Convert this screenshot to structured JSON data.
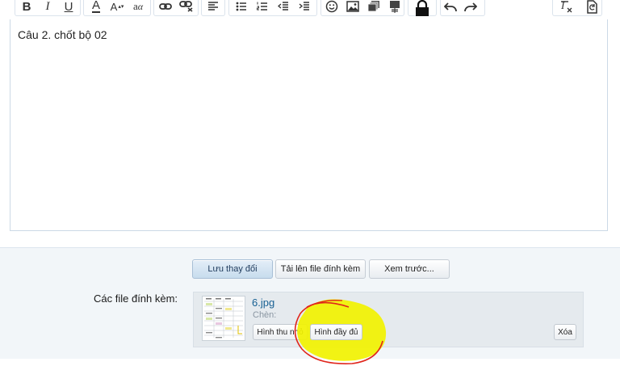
{
  "toolbar": {
    "icons": [
      "bold-icon",
      "italic-icon",
      "underline-icon",
      "text-color-icon",
      "font-size-icon",
      "font-family-icon",
      "link-icon",
      "unlink-icon",
      "align-left-icon",
      "bullet-list-icon",
      "numbered-list-icon",
      "outdent-icon",
      "indent-icon",
      "smilie-icon",
      "image-icon",
      "media-icon",
      "quote-icon",
      "lock-icon",
      "undo-icon",
      "redo-icon",
      "remove-format-icon",
      "toggle-bbcode-icon"
    ],
    "bold_label": "B",
    "italic_label": "I",
    "underline_label": "U",
    "text_color_label": "A",
    "font_size_label": "A",
    "font_family_label": "a"
  },
  "editor": {
    "content": "Câu 2. chốt bộ 02"
  },
  "actions": {
    "save_label": "Lưu thay đổi",
    "upload_label": "Tải lên file đính kèm",
    "preview_label": "Xem trước..."
  },
  "attachments": {
    "label": "Các file đính kèm:",
    "items": [
      {
        "file_name": "6.jpg",
        "insert_label": "Chèn:",
        "thumbnail_button": "Hình thu nhỏ",
        "full_image_button": "Hình đầy đủ",
        "delete_button": "Xóa"
      }
    ]
  },
  "colors": {
    "primary_button": "#c7dced",
    "link": "#176093",
    "highlight": "#f2f200",
    "annotation_stroke": "#e0251b"
  }
}
